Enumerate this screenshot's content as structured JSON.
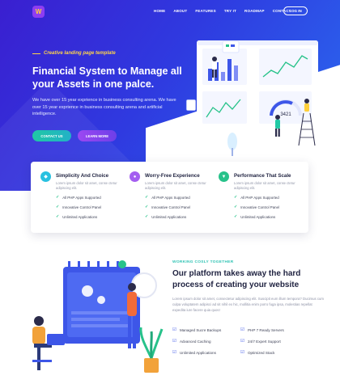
{
  "header": {
    "logo_text": "W",
    "nav": [
      "HOME",
      "ABOUT",
      "FEATURES",
      "TRY IT",
      "ROADMAP",
      "CONTACT"
    ],
    "login_label": "LOG IN"
  },
  "hero": {
    "tagline": "Creative landing page template",
    "title": "Financial System to Manage all your Assets in one palce.",
    "description": "We have over 15 year exprience in business consulting arena. We have over 15 year exprience in business consulting arena and artificial intelligence.",
    "contact_label": "CONTACT US",
    "learn_label": "LEARN MORE",
    "illustration_value": "3421"
  },
  "features": [
    {
      "title": "Simplicity And Choice",
      "description": "Lorem ipsum dolor sit amet, conse ctetur adipiscing elit.",
      "items": [
        "All PHP Apps Supported",
        "Innovative Control Panel",
        "Unlimited Applications"
      ],
      "icon": "layers-icon",
      "color": "#29c1e0"
    },
    {
      "title": "Worry-Free Experience",
      "description": "Lorem ipsum dolor sit amet, conse ctetur adipiscing elit.",
      "items": [
        "All PHP Apps Supported",
        "Innovative Control Panel",
        "Unlimited Applications"
      ],
      "icon": "user-icon",
      "color": "#a45ef0"
    },
    {
      "title": "Performance That Scale",
      "description": "Lorem ipsum dolor sit amet, conse ctetur adipiscing elit.",
      "items": [
        "All PHP Apps Supported",
        "Innovative Control Panel",
        "Unlimited Applications"
      ],
      "icon": "shield-icon",
      "color": "#27c28a"
    }
  ],
  "section2": {
    "eyebrow": "WORKING COSLY TOGETHER",
    "title": "Our platform takes away the hard process of creating your website",
    "description": "Lorem ipsum dolor sit amet, consectetur adipiscing elit. Suscipit eum illum tempora? Ducimus cum culpa voluptatem adipisci ad sit nihil ex hic, mollitia enim porro fuga ipsa, molestias repellat expedita iure facere quia quos!",
    "services": [
      "Managed Sucre Backups",
      "PHP 7 Ready Servers",
      "Advanced Caching",
      "24/7 Expert Support",
      "Unlimited Applications",
      "Optimized Stack"
    ]
  },
  "colors": {
    "hero_start": "#3a1fd0",
    "hero_end": "#2a6df0",
    "accent_yellow": "#ffd54a",
    "teal": "#20c8a5",
    "purple": "#9c48f2"
  }
}
